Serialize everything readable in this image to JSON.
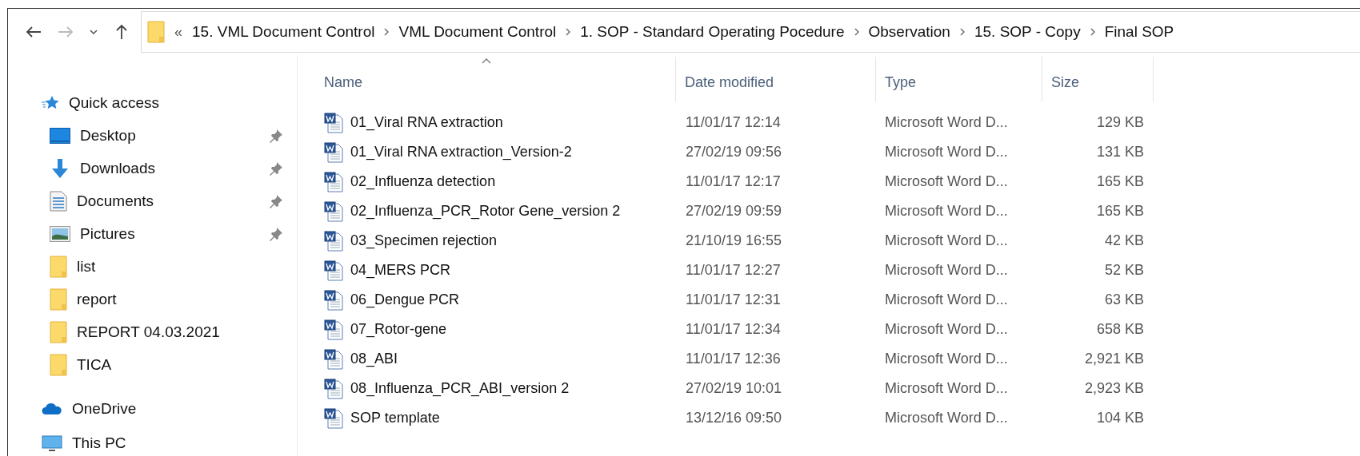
{
  "address_bar": {
    "overflow": "«",
    "crumbs": [
      "15. VML Document Control",
      "VML Document Control",
      "1. SOP - Standard Operating Pocedure",
      "Observation",
      "15. SOP - Copy",
      "Final SOP"
    ]
  },
  "sidebar": {
    "items": [
      {
        "label": "Quick access",
        "kind": "quick",
        "children": [
          {
            "label": "Desktop",
            "kind": "desktop",
            "pinned": true
          },
          {
            "label": "Downloads",
            "kind": "downloads",
            "pinned": true
          },
          {
            "label": "Documents",
            "kind": "documents",
            "pinned": true
          },
          {
            "label": "Pictures",
            "kind": "pictures",
            "pinned": true
          },
          {
            "label": "list",
            "kind": "folder",
            "pinned": false
          },
          {
            "label": "report",
            "kind": "folder",
            "pinned": false
          },
          {
            "label": "REPORT 04.03.2021",
            "kind": "folder",
            "pinned": false
          },
          {
            "label": "TICA",
            "kind": "folder",
            "pinned": false
          }
        ]
      },
      {
        "label": "OneDrive",
        "kind": "cloud"
      },
      {
        "label": "This PC",
        "kind": "pc"
      }
    ]
  },
  "table": {
    "columns": [
      {
        "label": "Name",
        "sorted": true
      },
      {
        "label": "Date modified",
        "sorted": false
      },
      {
        "label": "Type",
        "sorted": false
      },
      {
        "label": "Size",
        "sorted": false
      }
    ],
    "rows": [
      {
        "name": "01_Viral RNA extraction",
        "date": "11/01/17 12:14",
        "type": "Microsoft Word D...",
        "size": "129 KB"
      },
      {
        "name": "01_Viral RNA extraction_Version-2",
        "date": "27/02/19 09:56",
        "type": "Microsoft Word D...",
        "size": "131 KB"
      },
      {
        "name": "02_Influenza detection",
        "date": "11/01/17 12:17",
        "type": "Microsoft Word D...",
        "size": "165 KB"
      },
      {
        "name": "02_Influenza_PCR_Rotor Gene_version 2",
        "date": "27/02/19 09:59",
        "type": "Microsoft Word D...",
        "size": "165 KB"
      },
      {
        "name": "03_Specimen rejection",
        "date": "21/10/19 16:55",
        "type": "Microsoft Word D...",
        "size": "42 KB"
      },
      {
        "name": "04_MERS PCR",
        "date": "11/01/17 12:27",
        "type": "Microsoft Word D...",
        "size": "52 KB"
      },
      {
        "name": "06_Dengue PCR",
        "date": "11/01/17 12:31",
        "type": "Microsoft Word D...",
        "size": "63 KB"
      },
      {
        "name": "07_Rotor-gene",
        "date": "11/01/17 12:34",
        "type": "Microsoft Word D...",
        "size": "658 KB"
      },
      {
        "name": "08_ABI",
        "date": "11/01/17 12:36",
        "type": "Microsoft Word D...",
        "size": "2,921 KB"
      },
      {
        "name": "08_Influenza_PCR_ABI_version 2",
        "date": "27/02/19 10:01",
        "type": "Microsoft Word D...",
        "size": "2,923 KB"
      },
      {
        "name": "SOP template",
        "date": "13/12/16 09:50",
        "type": "Microsoft Word D...",
        "size": "104 KB"
      }
    ]
  }
}
